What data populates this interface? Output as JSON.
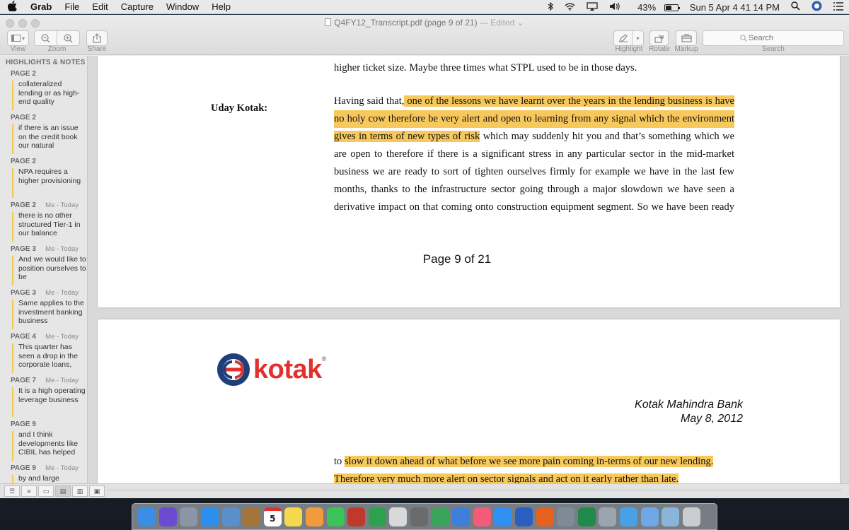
{
  "menubar": {
    "apple": "",
    "items": [
      "Grab",
      "File",
      "Edit",
      "Capture",
      "Window",
      "Help"
    ],
    "status": {
      "battery": "43%",
      "clock": "Sun 5 Apr  4 41 14 PM"
    }
  },
  "window": {
    "title": "Q4FY12_Transcript.pdf (page 9 of 21)",
    "edited": "— Edited",
    "toolbar": {
      "view_label": "View",
      "zoom_label": "Zoom",
      "share_label": "Share",
      "highlight_label": "Highlight",
      "rotate_label": "Rotate",
      "markup_label": "Markup",
      "search_label": "Search",
      "search_placeholder": "Search"
    }
  },
  "sidebar": {
    "heading": "HIGHLIGHTS & NOTES",
    "notes": [
      {
        "page": "PAGE 2",
        "author": "",
        "text": "collateralized lending or as high-end quality"
      },
      {
        "page": "PAGE 2",
        "author": "",
        "text": "if there is an issue on the credit book our natural"
      },
      {
        "page": "PAGE 2",
        "author": "",
        "text": "NPA requires a higher provisioning"
      },
      {
        "page": "PAGE 2",
        "author": "Me - Today",
        "text": "there is no other structured Tier-1 in our balance"
      },
      {
        "page": "PAGE 3",
        "author": "Me - Today",
        "text": "And we would like to position ourselves to be"
      },
      {
        "page": "PAGE 3",
        "author": "Me - Today",
        "text": "Same applies to the investment banking business"
      },
      {
        "page": "PAGE 4",
        "author": "Me - Today",
        "text": "This quarter has seen a drop in the corporate loans,"
      },
      {
        "page": "PAGE 7",
        "author": "Me - Today",
        "text": "It is a high operating leverage business"
      },
      {
        "page": "PAGE 9",
        "author": "",
        "text": "and I think developments like CIBIL has helped"
      },
      {
        "page": "PAGE 9",
        "author": "Me - Today",
        "text": "by and large"
      }
    ]
  },
  "document": {
    "page9": {
      "top_line": "higher ticket size. Maybe three times what STPL used to be in those days.",
      "speaker": "Uday Kotak:",
      "l1_pre": "Having said that,",
      "l1_hl": " one of the lessons we have learnt over the years in the lending business is have",
      "l2_hl": "no holy cow therefore be very alert and open to learning from any signal which the environment",
      "l3_hl": "gives in terms of new types of risk",
      "l3_post": " which may suddenly hit you and that’s something which we",
      "l4": "are open to therefore if there is a significant stress in any particular sector in the mid-market",
      "l5": "business we are ready to sort of tighten ourselves firmly for example we have in the last few",
      "l6": "months, thanks to the infrastructure sector going through a major slowdown we have seen a",
      "l7": "derivative impact on that coming onto construction equipment segment. So we have been ready",
      "page_number": "Page 9 of 21"
    },
    "page10": {
      "logo_text": "kotak",
      "logo_reg": "®",
      "bank_name": "Kotak Mahindra Bank",
      "date": "May 8, 2012",
      "l1_pre": "to ",
      "l1_hl": "slow it down ahead of what before we see more pain coming in-terms of our new lending.",
      "l2_hl": "Therefore very much more alert on sector signals and act on it early rather than late."
    }
  },
  "dock": {
    "calendar_day": "5",
    "items": [
      {
        "name": "finder-icon",
        "color": "#3a8ee6"
      },
      {
        "name": "siri-icon",
        "color": "#6a4bd1"
      },
      {
        "name": "launchpad-icon",
        "color": "#8a96a6"
      },
      {
        "name": "safari-icon",
        "color": "#2c8ff0"
      },
      {
        "name": "preview-icon",
        "color": "#5a8fc9"
      },
      {
        "name": "notes-brown-icon",
        "color": "#a3743a"
      },
      {
        "name": "calendar-icon",
        "color": "#ffffff"
      },
      {
        "name": "notes-icon",
        "color": "#f5d94c"
      },
      {
        "name": "photos-icon",
        "color": "#f29b3c"
      },
      {
        "name": "messages-icon",
        "color": "#3cc35a"
      },
      {
        "name": "photo-booth-icon",
        "color": "#c0392b"
      },
      {
        "name": "facetime-icon",
        "color": "#2ea14f"
      },
      {
        "name": "textedit-icon",
        "color": "#d9d9d9"
      },
      {
        "name": "notebook-icon",
        "color": "#6b6b6b"
      },
      {
        "name": "numbers-icon",
        "color": "#3aa35a"
      },
      {
        "name": "keynote-icon",
        "color": "#3d7fd9"
      },
      {
        "name": "music-icon",
        "color": "#f45a7a"
      },
      {
        "name": "app-store-icon",
        "color": "#2f8ff2"
      },
      {
        "name": "word-icon",
        "color": "#2b5fbf"
      },
      {
        "name": "firefox-icon",
        "color": "#e6601e"
      },
      {
        "name": "system-preferences-icon",
        "color": "#7e8a96"
      },
      {
        "name": "excel-icon",
        "color": "#1f8a4a"
      },
      {
        "name": "grab-icon",
        "color": "#9aa5b0"
      },
      {
        "name": "chat-icon",
        "color": "#4aa0e6"
      },
      {
        "name": "mail-icon",
        "color": "#6ea8e6"
      },
      {
        "name": "downloads-icon",
        "color": "#8ab4d9"
      },
      {
        "name": "trash-icon",
        "color": "#c9cdd2"
      }
    ]
  }
}
